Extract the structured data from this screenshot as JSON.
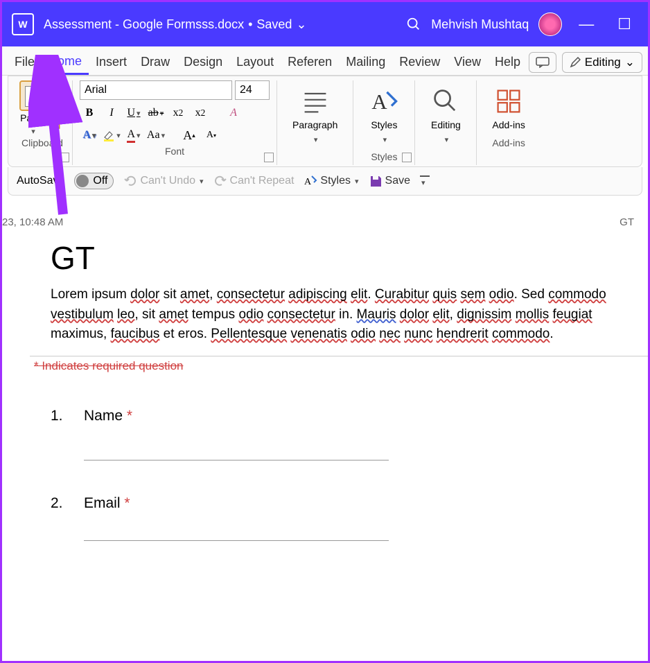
{
  "titlebar": {
    "app": "W",
    "filename": "Assessment - Google Formsss.docx",
    "saved_label": "Saved",
    "user": "Mehvish Mushtaq"
  },
  "menu": [
    "File",
    "Home",
    "Insert",
    "Draw",
    "Design",
    "Layout",
    "Referen",
    "Mailing",
    "Review",
    "View",
    "Help"
  ],
  "menu_active": 1,
  "editing_label": "Editing",
  "ribbon": {
    "clipboard": {
      "paste": "Paste",
      "label": "Clipboard"
    },
    "font": {
      "name": "Arial",
      "size": "24",
      "label": "Font",
      "bold": "B",
      "italic": "I",
      "underline": "U",
      "strike": "ab",
      "sub": "x",
      "sup": "x",
      "clear": "A",
      "texteffect": "A",
      "highlight": "",
      "color": "A",
      "case": "Aa",
      "grow": "A",
      "shrink": "A"
    },
    "paragraph": {
      "label": "Paragraph"
    },
    "styles": {
      "label": "Styles"
    },
    "editing": {
      "label": "Editing"
    },
    "addins": {
      "label": "Add-ins"
    }
  },
  "qat": {
    "autosave": "AutoSave",
    "autosave_state": "Off",
    "undo": "Can't Undo",
    "redo": "Can't Repeat",
    "styles": "Styles",
    "save": "Save"
  },
  "document": {
    "header_left": "23, 10:48 AM",
    "header_right": "GT",
    "title": "GT",
    "body": "Lorem ipsum dolor sit amet, consectetur adipiscing elit. Curabitur quis sem odio. Sed commodo vestibulum leo, sit amet tempus odio consectetur in. Mauris dolor elit, dignissim mollis feugiat maximus, faucibus et eros. Pellentesque venenatis odio nec nunc hendrerit commodo.",
    "required_note": "* Indicates required question",
    "questions": [
      {
        "num": "1.",
        "label": "Name",
        "required": true
      },
      {
        "num": "2.",
        "label": "Email",
        "required": true
      }
    ]
  }
}
